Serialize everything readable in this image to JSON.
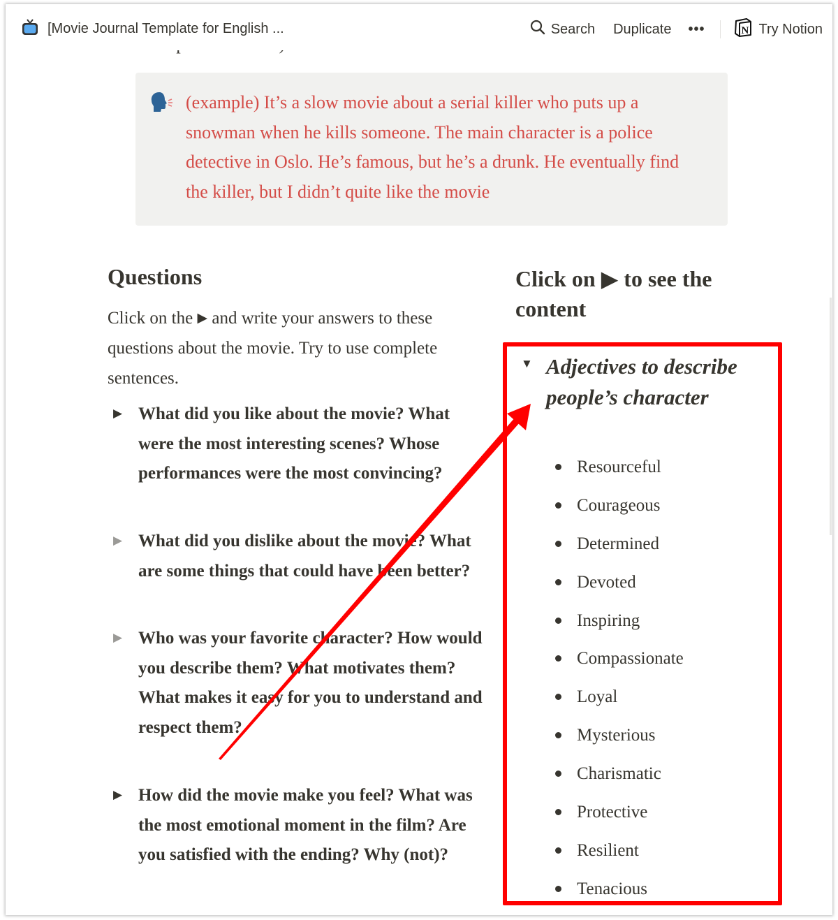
{
  "topbar": {
    "page_icon": "tv-icon",
    "title": "[Movie Journal Template for English ...",
    "search_label": "Search",
    "duplicate_label": "Duplicate",
    "more_label": "•••",
    "try_notion_label": "Try Notion"
  },
  "clipped_text": "example text below)",
  "callout": {
    "icon": "speaking-head-icon",
    "text": "(example) It’s a slow movie about a serial killer who puts up a snowman when he kills someone. The main character is a police detective in Oslo. He’s famous, but he’s a drunk. He eventually find the killer, but I didn’t quite like the movie",
    "text_color": "#d44c47",
    "background": "#f1f1ef"
  },
  "questions": {
    "heading": "Questions",
    "intro_before": "Click on the",
    "intro_arrow": "▶",
    "intro_after": "and write your answers to these questions about the movie. Try to use complete sentences.",
    "toggles": [
      {
        "arrow": "▶",
        "state": "collapsed",
        "text": "What did you like about the movie? What were the most interesting scenes? Whose performances were the most convincing?"
      },
      {
        "arrow": "▶",
        "state": "collapsed",
        "text": "What did you dislike about the movie? What are some things that could have been better?"
      },
      {
        "arrow": "▶",
        "state": "collapsed",
        "text": "Who was your favorite character? How would you describe them? What motivates them? What makes it easy for you to understand and respect them?"
      },
      {
        "arrow": "▶",
        "state": "collapsed",
        "text": "How did the movie make you feel? What was the most emotional moment in the film? Are you satisfied with the ending? Why (not)?"
      }
    ]
  },
  "content_panel": {
    "heading": "Click on ▶ to see the content",
    "toggle": {
      "arrow": "▼",
      "state": "expanded",
      "title": "Adjectives to describe people’s character",
      "items": [
        "Resourceful",
        "Courageous",
        "Determined",
        "Devoted",
        "Inspiring",
        "Compassionate",
        "Loyal",
        "Mysterious",
        "Charismatic",
        "Protective",
        "Resilient",
        "Tenacious"
      ]
    }
  },
  "annotation": {
    "color": "#ff0000",
    "highlight": "Adjectives to describe people’s character toggle",
    "arrow_target": "Adjectives to describe people’s character toggle"
  }
}
